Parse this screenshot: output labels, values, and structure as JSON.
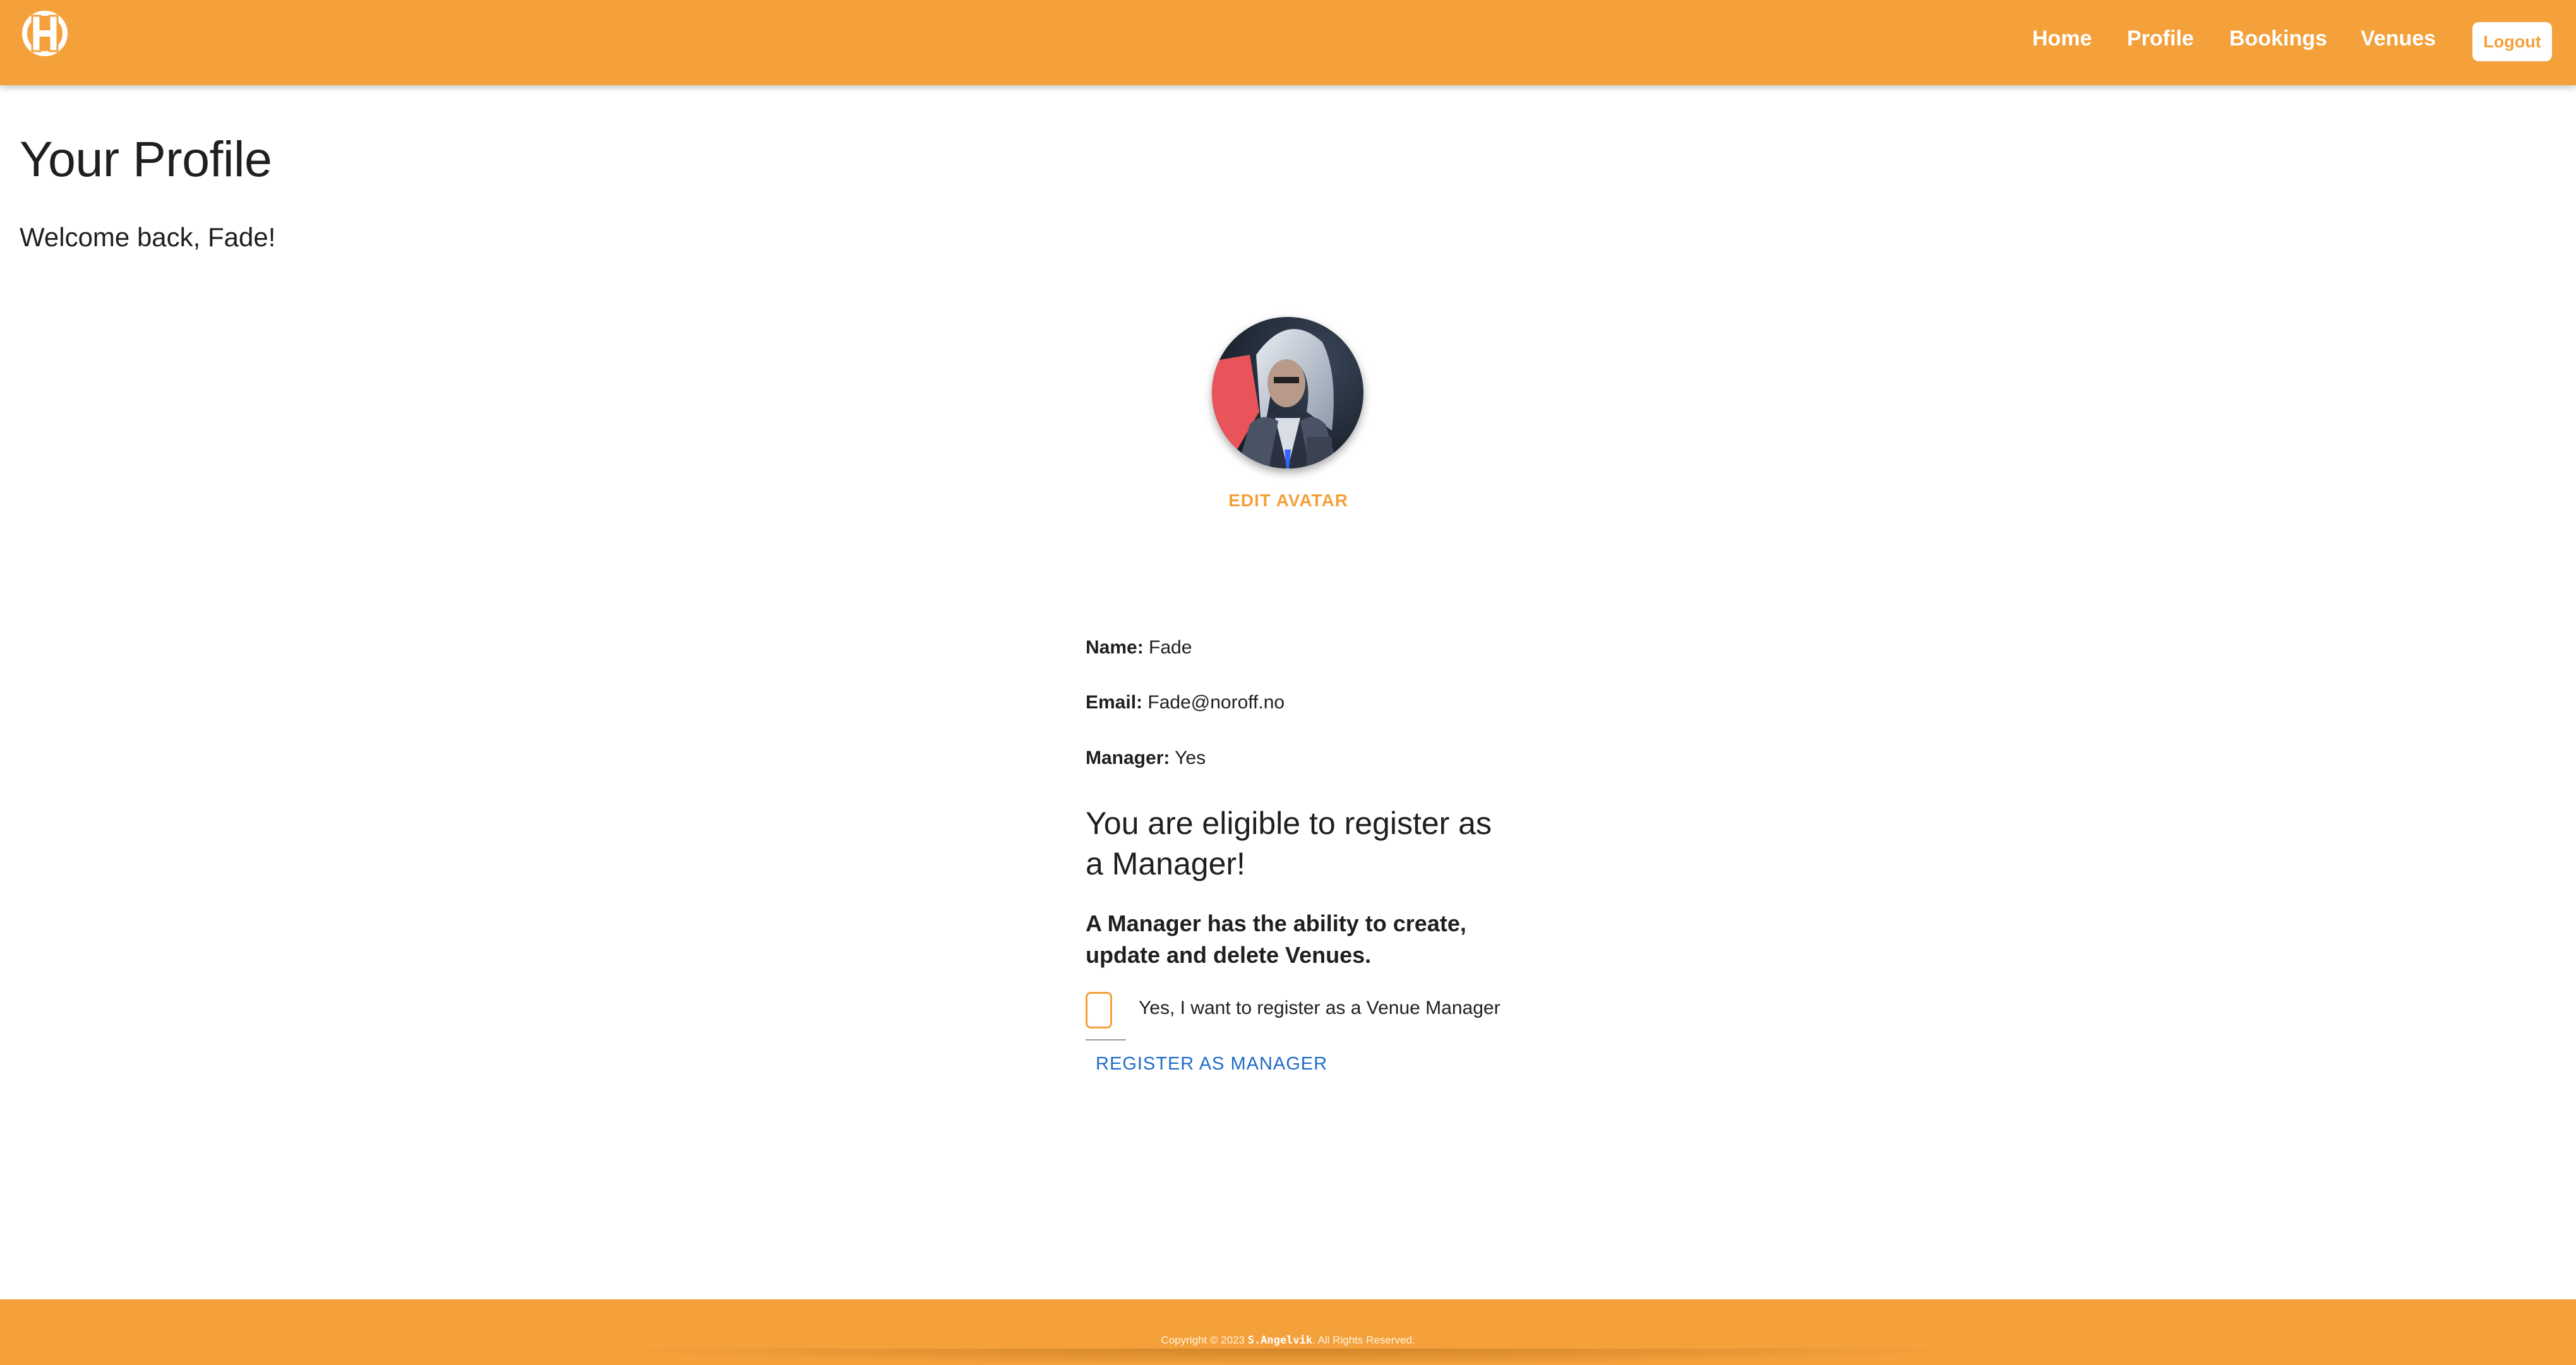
{
  "header": {
    "logo_icon": "h-circle-logo-icon",
    "nav": [
      {
        "label": "Home"
      },
      {
        "label": "Profile"
      },
      {
        "label": "Bookings"
      },
      {
        "label": "Venues"
      }
    ],
    "logout_label": "Logout"
  },
  "main": {
    "title": "Your Profile",
    "welcome": "Welcome back, Fade!",
    "edit_avatar_label": "EDIT AVATAR",
    "profile": {
      "name_label": "Name:",
      "name_value": "Fade",
      "email_label": "Email:",
      "email_value": "Fade@noroff.no",
      "manager_label": "Manager:",
      "manager_value": "Yes"
    },
    "eligible_heading": "You are eligible to register as a Manager!",
    "manager_description": "A Manager has the ability to create, update and delete Venues.",
    "checkbox_label": "Yes, I want to register as a Venue Manager",
    "register_label": "REGISTER AS MANAGER"
  },
  "footer": {
    "copyright_prefix": "Copyright © 2023",
    "author": "S.Angelvik",
    "copyright_suffix": ". All Rights Reserved."
  },
  "colors": {
    "brand": "#F4A03B",
    "link_blue": "#1E6CC8"
  }
}
